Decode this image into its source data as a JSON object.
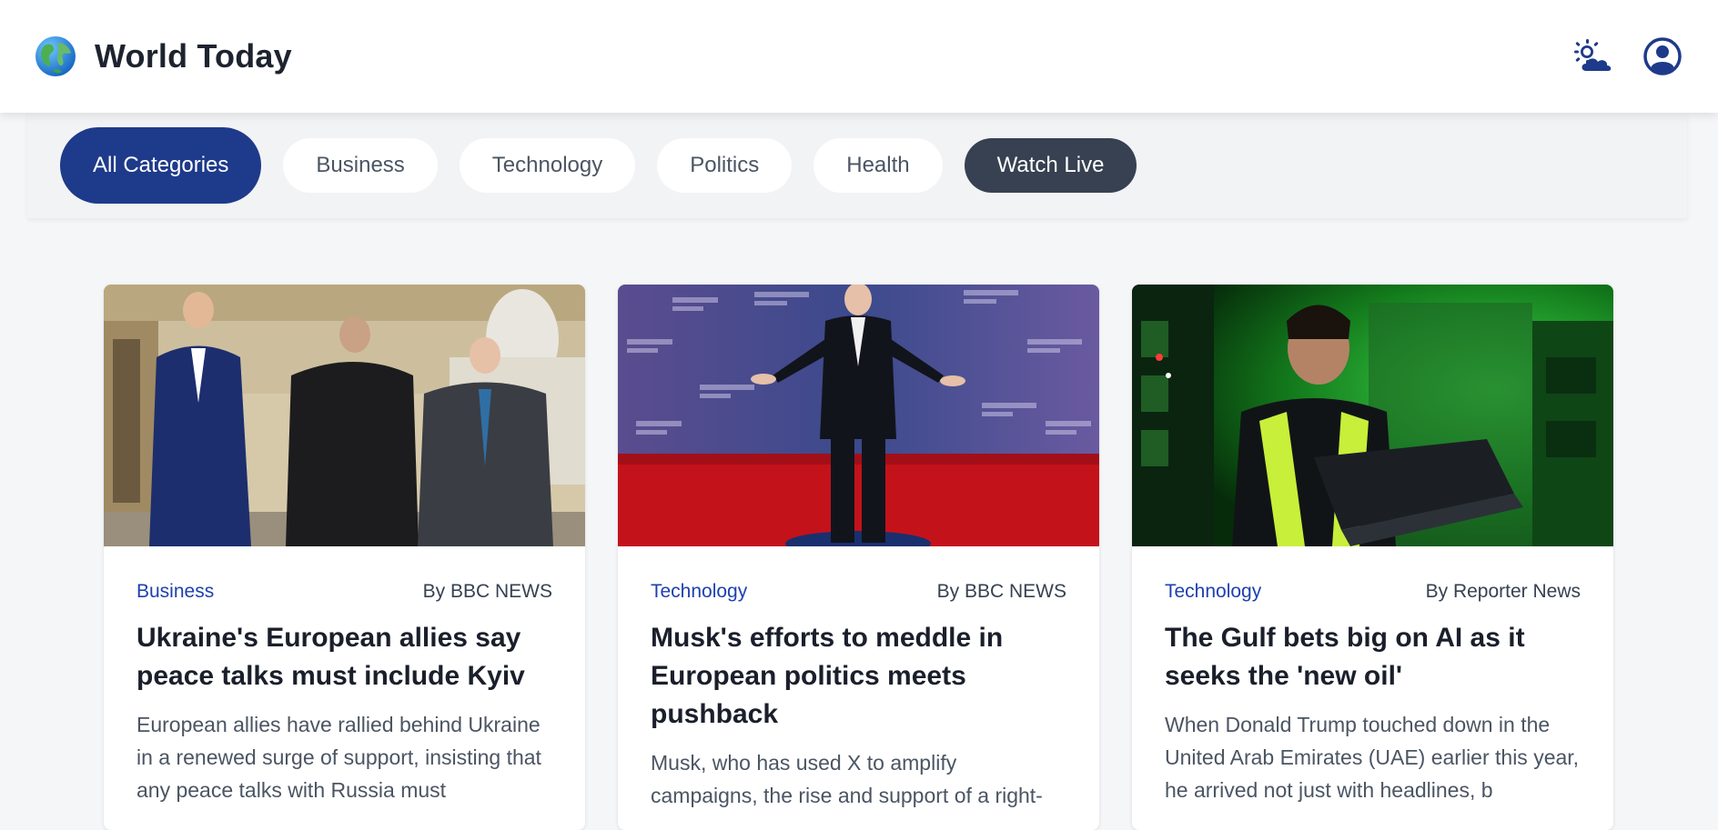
{
  "header": {
    "title": "World Today",
    "logo_icon": "globe-icon",
    "weather_icon": "sun-cloud-icon",
    "profile_icon": "user-circle-icon",
    "accent_color": "#1e3a8a"
  },
  "filters": {
    "items": [
      {
        "label": "All Categories",
        "state": "active"
      },
      {
        "label": "Business"
      },
      {
        "label": "Technology"
      },
      {
        "label": "Politics"
      },
      {
        "label": "Health"
      },
      {
        "label": "Watch Live",
        "state": "dark"
      }
    ]
  },
  "articles": [
    {
      "category": "Business",
      "author": "By BBC NEWS",
      "title": "Ukraine's European allies say peace talks must include Kyiv",
      "summary": "European allies have rallied behind Ukraine in a renewed surge of support, insisting that any peace talks with Russia must"
    },
    {
      "category": "Technology",
      "author": "By BBC NEWS",
      "title": "Musk's efforts to meddle in European politics meets pushback",
      "summary": "Musk, who has used X to amplify campaigns, the rise and support of a right-"
    },
    {
      "category": "Technology",
      "author": "By Reporter News",
      "title": "The Gulf bets big on AI as it seeks the 'new oil'",
      "summary": "When Donald Trump touched down in the United Arab Emirates (UAE) earlier this year, he arrived not just with headlines, b"
    }
  ]
}
